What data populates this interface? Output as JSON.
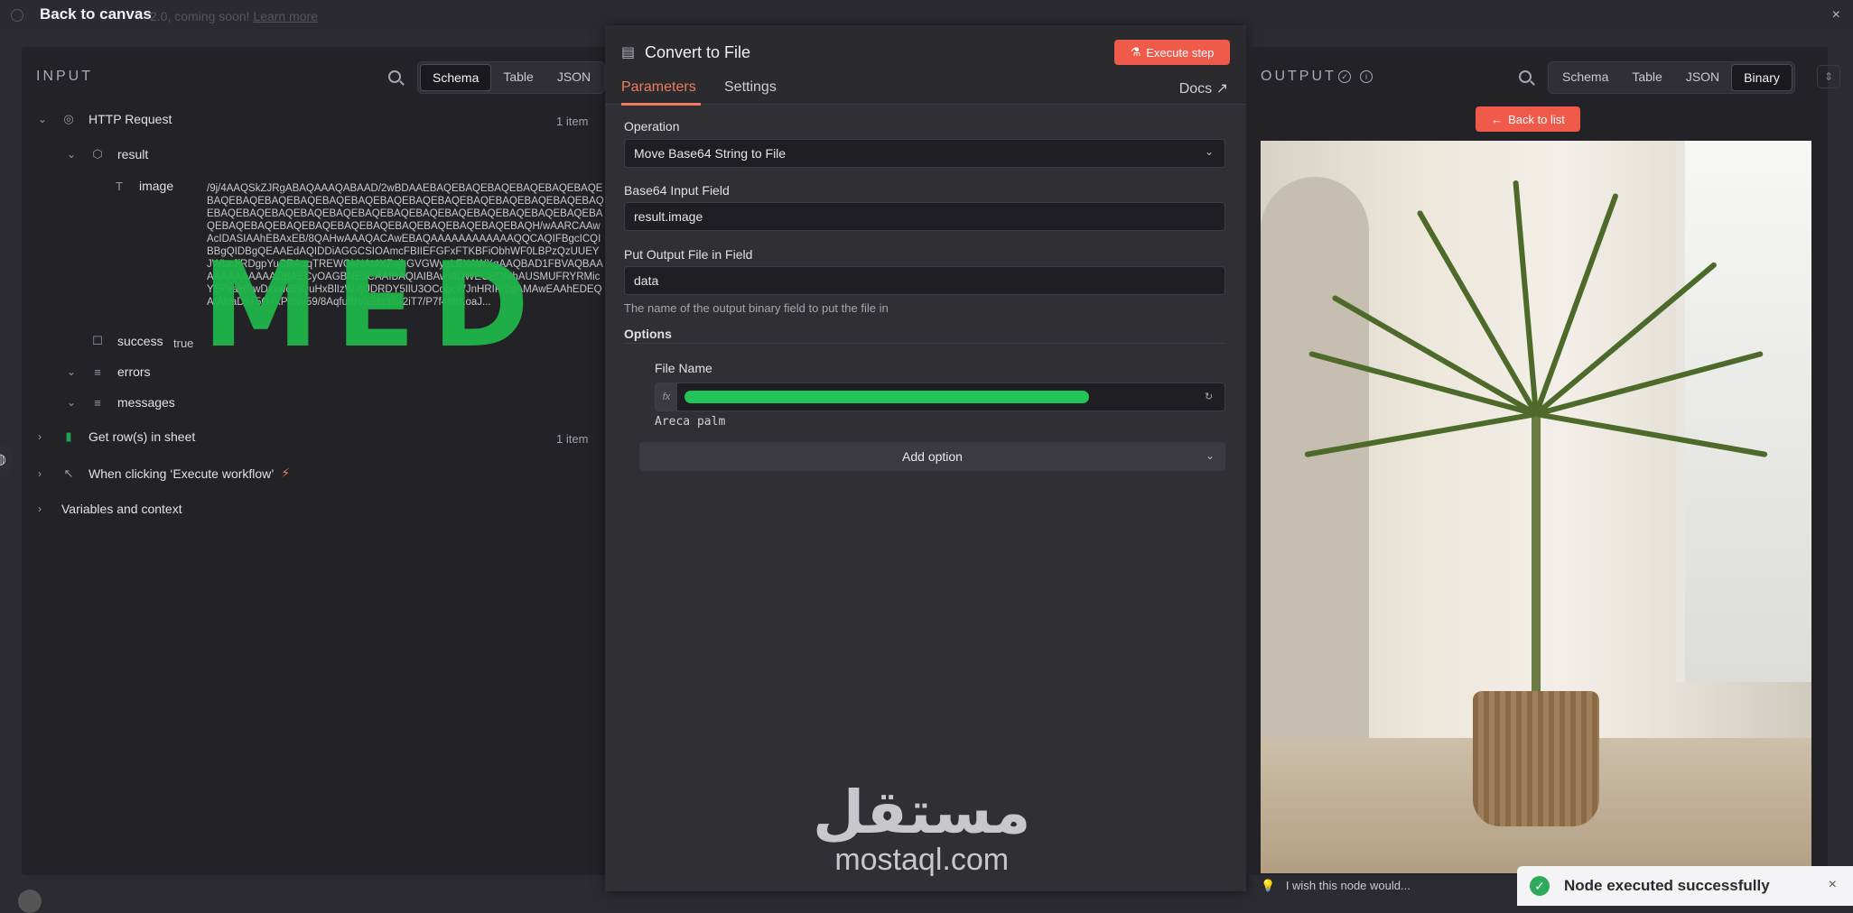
{
  "topbar": {
    "back_label": "Back to canvas",
    "banner_text": "2.0, coming soon!",
    "banner_link": "Learn more",
    "close": "×"
  },
  "input": {
    "title": "INPUT",
    "views": [
      "Schema",
      "Table",
      "JSON"
    ],
    "active_view": "Schema",
    "tree": {
      "http_request": {
        "label": "HTTP Request",
        "count": "1 item"
      },
      "result": {
        "label": "result"
      },
      "image": {
        "label": "image",
        "value": "/9j/4AAQSkZJRgABAQAAAQABAAD/2wBDAAEBAQEBAQEBAQEBAQEBAQEBAQEBAQEBAQEBAQEBAQEBAQEBAQEBAQEBAQEBAQEBAQEBAQEBAQEBAQEBAQEBAQEBAQEBAQEBAQEBAQEBAQEBAQEBAQEBAQEBAQEBAQEBAQEBAQEBAQEBAQEBAQEBAQEBAQEBAQEBAQEBAQEBAQEBAQEBAQEBAQH/wAARCAAwAcIDASIAAhEBAxEB/8QAHwAAAQACAwEBAQAAAAAAAAAAAAQQCAQIFBgcICQIBBgQIDBgQEAAEdAQIDDiAGGCSIOAmcFBIIEFGFxFTKBFiObhWF0LBPzQzUUEYJWLxJjRDgpYuCRAoqTREWGkNAt4XZojhGVGWyqLEXAWXgAAQBAD1FBVAQBAAAAAAAAAAAADBAECyOAGBNEIICAAIBAQIAIBAwIADWECEQMhAUSMUFRYRMicYEFkaHRwDxxwdEjQuHxBlIzWJyJDRDY5IlU3OCogcWJnHRIP/2gAMAwEAAhEDEQA/ANaDs+5O+xPc/vv59/8AqfufBVaSfq33+2iT7/P7f468KoaJ..."
      },
      "success": {
        "label": "success",
        "value": "true"
      },
      "errors": {
        "label": "errors"
      },
      "messages": {
        "label": "messages"
      },
      "get_rows": {
        "label": "Get row(s) in sheet",
        "count": "1 item"
      },
      "when_clicking": {
        "label": "When clicking ‘Execute workflow’"
      },
      "variables": {
        "label": "Variables and context"
      }
    },
    "overlay_text": "MED"
  },
  "node": {
    "title": "Convert to File",
    "execute_label": "Execute step",
    "tabs": [
      "Parameters",
      "Settings"
    ],
    "active_tab": "Parameters",
    "docs_label": "Docs",
    "operation": {
      "label": "Operation",
      "value": "Move Base64 String to File"
    },
    "base64_field": {
      "label": "Base64 Input Field",
      "value": "result.image"
    },
    "output_field": {
      "label": "Put Output File in Field",
      "value": "data",
      "hint": "The name of the output binary field to put the file in"
    },
    "options_label": "Options",
    "file_name": {
      "label": "File Name",
      "fx": "fx",
      "preview": "Areca palm"
    },
    "add_option_label": "Add option"
  },
  "output": {
    "title": "OUTPUT",
    "views": [
      "Schema",
      "Table",
      "JSON",
      "Binary"
    ],
    "active_view": "Binary",
    "back_to_list": "Back to list",
    "feedback_text": "I wish this node would..."
  },
  "toast": {
    "message": "Node executed successfully",
    "close": "×"
  },
  "watermark": {
    "arabic": "مستقل",
    "latin": "mostaql.com"
  },
  "colors": {
    "accent": "#ef5a4b",
    "tab_active": "#ef7b60",
    "success": "#2eaa5c",
    "scribble": "#23c457"
  }
}
